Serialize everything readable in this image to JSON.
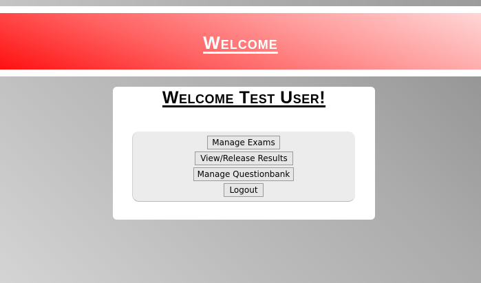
{
  "banner": {
    "title": "Welcome"
  },
  "card": {
    "title": "Welcome Test User!"
  },
  "menu": {
    "manage_exams": "Manage Exams",
    "view_release_results": "View/Release Results",
    "manage_questionbank": "Manage Questionbank",
    "logout": "Logout"
  },
  "colors": {
    "banner_red": "#ff1a1a",
    "banner_pink": "#ffd6d6",
    "menu_bg": "#ececec"
  }
}
